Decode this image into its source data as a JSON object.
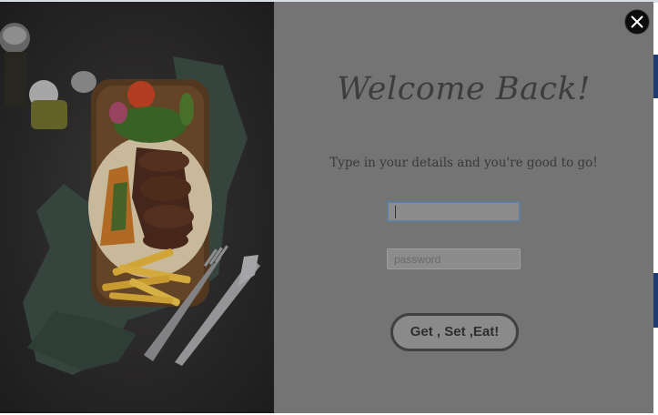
{
  "modal": {
    "title": "Welcome Back!",
    "subtitle": "Type in your details and you're good to go!",
    "username_value": "",
    "username_placeholder": "",
    "password_placeholder": "password",
    "submit_label": "Get , Set ,Eat!"
  },
  "icons": {
    "close": "close-icon",
    "photo": "food-platter-photo"
  },
  "colors": {
    "overlay": "#747474",
    "title": "#3d3d3d",
    "button_border": "#404040",
    "close_button": "#0c0c0c"
  }
}
